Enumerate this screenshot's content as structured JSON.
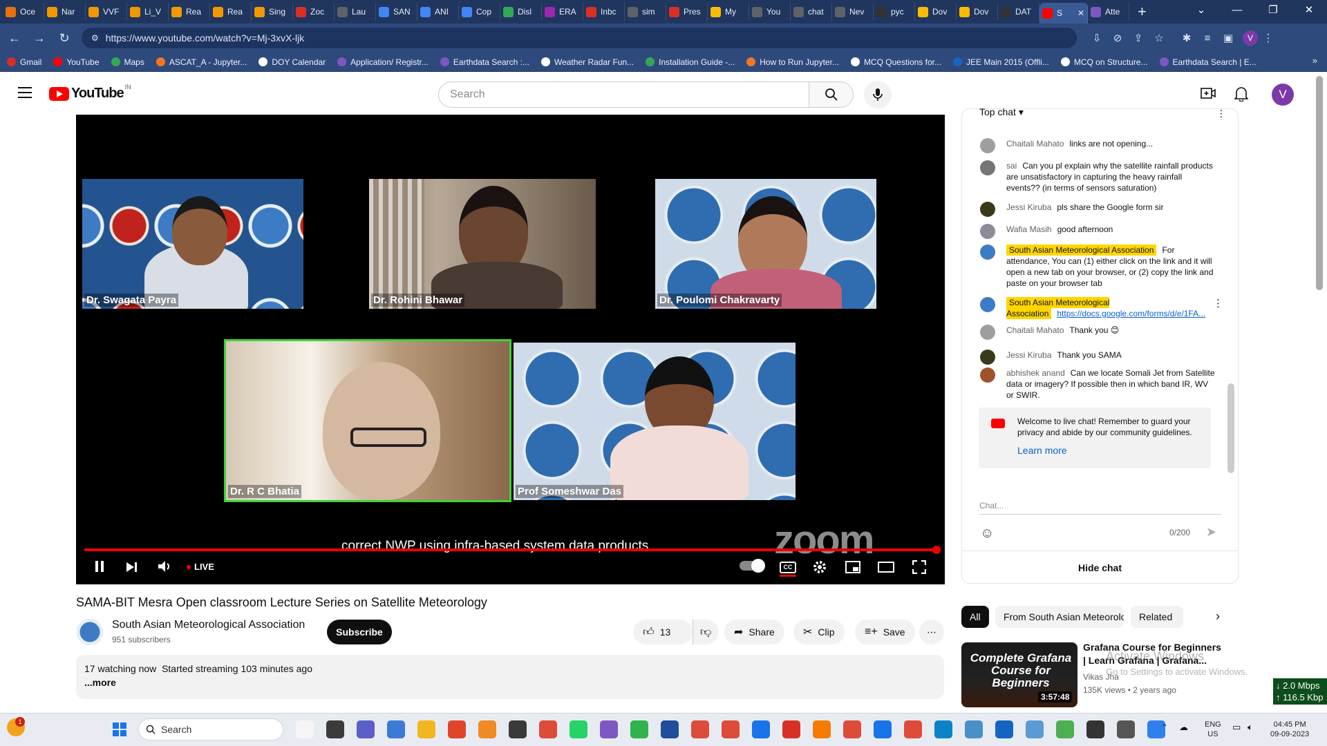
{
  "browser": {
    "tabs": [
      {
        "label": "Oce",
        "color": "#e8710a"
      },
      {
        "label": "Nar",
        "color": "#f29900"
      },
      {
        "label": "VVF",
        "color": "#f29900"
      },
      {
        "label": "Li_V",
        "color": "#f29900"
      },
      {
        "label": "Rea",
        "color": "#f29900"
      },
      {
        "label": "Rea",
        "color": "#f29900"
      },
      {
        "label": "Sing",
        "color": "#f29900"
      },
      {
        "label": "Zoc",
        "color": "#d93025"
      },
      {
        "label": "Lau",
        "color": "#5f6368"
      },
      {
        "label": "SAN",
        "color": "#4285f4"
      },
      {
        "label": "ANI",
        "color": "#4285f4"
      },
      {
        "label": "Cop",
        "color": "#4285f4"
      },
      {
        "label": "Disl",
        "color": "#34a853"
      },
      {
        "label": "ERA",
        "color": "#9c27b0"
      },
      {
        "label": "Inbc",
        "color": "#d93025"
      },
      {
        "label": "sim",
        "color": "#5f6368"
      },
      {
        "label": "Pres",
        "color": "#d93025"
      },
      {
        "label": "My",
        "color": "#fbbc04"
      },
      {
        "label": "You",
        "color": "#5f6368"
      },
      {
        "label": "chat",
        "color": "#5f6368"
      },
      {
        "label": "Nev",
        "color": "#5f6368"
      },
      {
        "label": "pyc",
        "color": "#333"
      },
      {
        "label": "Dov",
        "color": "#fbbc04"
      },
      {
        "label": "Dov",
        "color": "#fbbc04"
      },
      {
        "label": "DAT",
        "color": "#333"
      },
      {
        "label": "S",
        "color": "#ff0000",
        "active": true
      },
      {
        "label": "Atte",
        "color": "#7e57c2"
      }
    ],
    "new_tab": "+",
    "window_controls": [
      "⌄",
      "—",
      "❐",
      "✕"
    ],
    "url": "https://www.youtube.com/watch?v=Mj-3xvX-ljk",
    "profile_initial": "V",
    "bookmarks": [
      {
        "label": "Gmail",
        "color": "#d93025"
      },
      {
        "label": "YouTube",
        "color": "#ff0000"
      },
      {
        "label": "Maps",
        "color": "#34a853"
      },
      {
        "label": "ASCAT_A - Jupyter...",
        "color": "#f37626"
      },
      {
        "label": "DOY Calendar",
        "color": "#ffffff"
      },
      {
        "label": "Application/ Registr...",
        "color": "#7e57c2"
      },
      {
        "label": "Earthdata Search :...",
        "color": "#7e57c2"
      },
      {
        "label": "Weather Radar Fun...",
        "color": "#ffffff"
      },
      {
        "label": "Installation Guide -...",
        "color": "#34a853"
      },
      {
        "label": "How to Run Jupyter...",
        "color": "#f37626"
      },
      {
        "label": "MCQ Questions for...",
        "color": "#ffffff"
      },
      {
        "label": "JEE Main 2015 (Offli...",
        "color": "#1565c0"
      },
      {
        "label": "MCQ on Structure...",
        "color": "#ffffff"
      },
      {
        "label": "Earthdata Search | E...",
        "color": "#7e57c2"
      }
    ]
  },
  "youtube": {
    "logo_text": "YouTube",
    "region": "IN",
    "search_placeholder": "Search",
    "avatar_initial": "V"
  },
  "player": {
    "participants": [
      {
        "name": "Dr. Swagata Payra"
      },
      {
        "name": "Dr. Rohini Bhawar"
      },
      {
        "name": "Dr. Poulomi Chakravarty"
      },
      {
        "name": "Dr. R C Bhatia",
        "active_speaker": true
      },
      {
        "name": "Prof Someshwar Das"
      }
    ],
    "caption": "correct NWP using infra-based system data products",
    "watermark": "zoom",
    "live_label": "LIVE",
    "cc_label": "CC",
    "accent_color": "#ff0000"
  },
  "video": {
    "title": "SAMA-BIT Mesra Open classroom Lecture Series on Satellite Meteorology",
    "channel": "South Asian Meteorological Association",
    "subscribers": "951 subscribers",
    "subscribe_label": "Subscribe",
    "likes": "13",
    "share_label": "Share",
    "clip_label": "Clip",
    "save_label": "Save",
    "watching": "17 watching now",
    "started": "Started streaming 103 minutes ago",
    "more_label": "...more"
  },
  "chat": {
    "header": "Top chat",
    "messages": [
      {
        "author": "Chaitali Mahato",
        "text": "links are not opening...",
        "avatar": "#9e9e9e"
      },
      {
        "author": "sai",
        "text": "Can you pl explain why the satellite rainfall products are unsatisfactory in capturing the heavy rainfall events?? (in terms of sensors saturation)",
        "avatar": "#757575"
      },
      {
        "author": "Jessi Kiruba",
        "text": "pls share the Google form sir",
        "avatar": "#3a3a1a"
      },
      {
        "author": "Wafia Masih",
        "text": "good afternoon",
        "avatar": "#8d8d9a"
      },
      {
        "author": "South Asian Meteorological Association",
        "text": "For attendance, You can (1) either click on the link and it will open a new tab on your browser, or (2) copy the link and paste on your browser tab",
        "avatar": "#3d7bc4",
        "highlight": true
      },
      {
        "author": "South Asian Meteorological Association",
        "text": "https://docs.google.com/forms/d/e/1FA...",
        "avatar": "#3d7bc4",
        "highlight": true,
        "link": true
      },
      {
        "author": "Chaitali Mahato",
        "text": "Thank you 😊",
        "avatar": "#9e9e9e"
      },
      {
        "author": "Jessi Kiruba",
        "text": "Thank you SAMA",
        "avatar": "#3a3a1a"
      },
      {
        "author": "abhishek anand",
        "text": "Can we locate Somali Jet from Satellite data or imagery? If possible then in which band IR, WV or SWIR.",
        "avatar": "#a0522d"
      }
    ],
    "welcome": "Welcome to live chat! Remember to guard your privacy and abide by our community guidelines.",
    "learn_more": "Learn more",
    "input_placeholder": "Chat...",
    "counter": "0/200",
    "hide_label": "Hide chat"
  },
  "related": {
    "chips": [
      "All",
      "From South Asian Meteorologi...",
      "Related"
    ],
    "item": {
      "thumb_text": "Complete Grafana Course for Beginners",
      "duration": "3:57:48",
      "title": "Grafana Course for Beginners | Learn Grafana | Grafana...",
      "channel": "Vikas Jha",
      "views": "135K views",
      "age": "2 years ago"
    }
  },
  "overlay": {
    "activate_title": "Activate Windows",
    "activate_sub": "Go to Settings to activate Windows.",
    "net_down": "↓ 2.0 Mbps",
    "net_up": "↑ 116.5 Kbp"
  },
  "taskbar": {
    "search_label": "Search",
    "weather_badge": "1",
    "lang_top": "ENG",
    "lang_bottom": "US",
    "time": "04:45 PM",
    "date": "09-09-2023",
    "icons": [
      "#f5f5f5",
      "#3b3b3b",
      "#5b5fc7",
      "#3b7bd4",
      "#f2b71f",
      "#e0442b",
      "#f08a24",
      "#3a3a3a",
      "#dd4b39",
      "#25d366",
      "#7e57c2",
      "#2fb34a",
      "#1e4e9c",
      "#dd4b39",
      "#dd4b39",
      "#1a73e8",
      "#d93025",
      "#f57c00",
      "#dd4b39",
      "#1a73e8",
      "#dd4b39",
      "#0a84c6",
      "#4a90c8",
      "#1565c0",
      "#5b9bd5",
      "#4caf50",
      "#333",
      "#555",
      "#2f80ed"
    ]
  }
}
